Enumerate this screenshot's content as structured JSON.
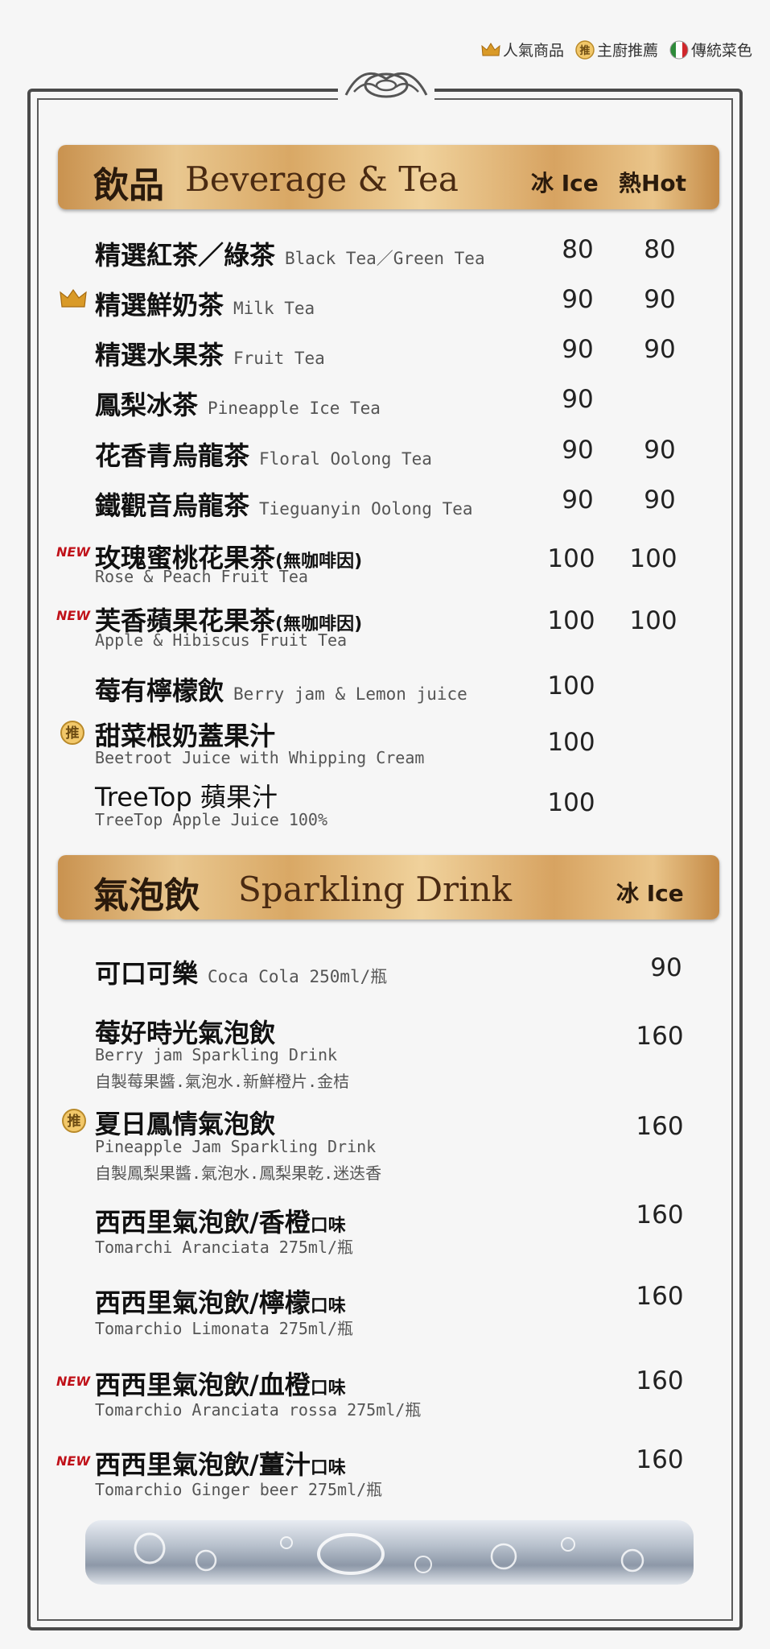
{
  "legend": {
    "popular": "人氣商品",
    "chef": "主廚推薦",
    "traditional": "傳統菜色"
  },
  "beverage": {
    "title_cn": "飲品",
    "title_en": "Beverage & Tea",
    "col_ice": "冰 Ice",
    "col_hot": "熱Hot",
    "items": [
      {
        "cn": "精選紅茶／綠茶",
        "en": "Black Tea／Green Tea",
        "ice": "80",
        "hot": "80"
      },
      {
        "cn": "精選鮮奶茶",
        "en": "Milk Tea",
        "ice": "90",
        "hot": "90"
      },
      {
        "cn": "精選水果茶",
        "en": "Fruit Tea",
        "ice": "90",
        "hot": "90"
      },
      {
        "cn": "鳳梨冰茶",
        "en": "Pineapple Ice Tea",
        "ice": "90",
        "hot": ""
      },
      {
        "cn": "花香青烏龍茶",
        "en": "Floral Oolong Tea",
        "ice": "90",
        "hot": "90"
      },
      {
        "cn": "鐵觀音烏龍茶",
        "en": "Tieguanyin Oolong Tea",
        "ice": "90",
        "hot": "90"
      },
      {
        "cn": "玫瑰蜜桃花果茶",
        "note": "(無咖啡因)",
        "sub": "Rose & Peach Fruit Tea",
        "ice": "100",
        "hot": "100"
      },
      {
        "cn": "芙香蘋果花果茶",
        "note": "(無咖啡因)",
        "sub": "Apple & Hibiscus Fruit Tea",
        "ice": "100",
        "hot": "100"
      },
      {
        "cn": "莓有檸檬飲",
        "en": "Berry jam & Lemon juice",
        "ice": "100",
        "hot": ""
      },
      {
        "cn": "甜菜根奶蓋果汁",
        "sub": "Beetroot Juice with Whipping Cream",
        "ice": "100",
        "hot": ""
      },
      {
        "cn": "TreeTop 蘋果汁",
        "sub": "TreeTop Apple Juice 100%",
        "ice": "100",
        "hot": ""
      }
    ]
  },
  "sparkling": {
    "title_cn": "氣泡飲",
    "title_en": "Sparkling Drink",
    "col_ice": "冰 Ice",
    "items": [
      {
        "cn": "可口可樂",
        "en": "Coca Cola 250ml/瓶",
        "price": "90"
      },
      {
        "cn": "莓好時光氣泡飲",
        "sub": "Berry jam Sparkling Drink",
        "sub2": "自製莓果醬.氣泡水.新鮮橙片.金桔",
        "price": "160"
      },
      {
        "cn": "夏日鳳情氣泡飲",
        "sub": "Pineapple Jam Sparkling Drink",
        "sub2": "自製鳳梨果醬.氣泡水.鳳梨果乾.迷迭香",
        "price": "160"
      },
      {
        "cn": "西西里氣泡飲/香橙",
        "flavor": "口味",
        "sub": "Tomarchi Aranciata 275ml/瓶",
        "price": "160"
      },
      {
        "cn": "西西里氣泡飲/檸檬",
        "flavor": "口味",
        "sub": "Tomarchio Limonata 275ml/瓶",
        "price": "160"
      },
      {
        "cn": "西西里氣泡飲/血橙",
        "flavor": "口味",
        "sub": "Tomarchio Aranciata rossa 275ml/瓶",
        "price": "160"
      },
      {
        "cn": "西西里氣泡飲/薑汁",
        "flavor": "口味",
        "sub": "Tomarchio Ginger beer 275ml/瓶",
        "price": "160"
      }
    ]
  },
  "badges": {
    "new": "NEW",
    "chef_char": "推"
  }
}
